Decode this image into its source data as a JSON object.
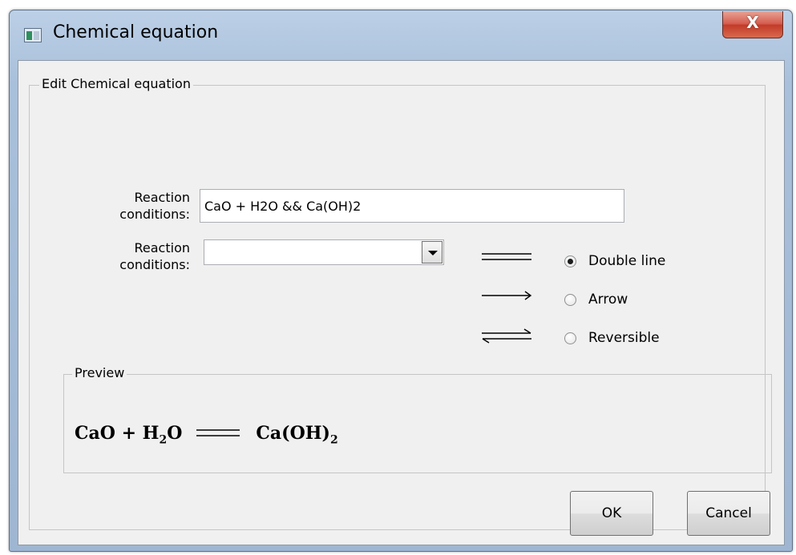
{
  "window": {
    "title": "Chemical equation",
    "close_label": "X"
  },
  "group": {
    "legend": "Edit Chemical equation"
  },
  "equation_field": {
    "label_line1": "Reaction",
    "label_line2": "conditions:",
    "value": "CaO + H2O && Ca(OH)2"
  },
  "conditions_field": {
    "label_line1": "Reaction",
    "label_line2": "conditions:",
    "selected": ""
  },
  "arrow_types": [
    {
      "label": "Double line",
      "symbol_icon": "double-line-icon",
      "selected": true
    },
    {
      "label": "Arrow",
      "symbol_icon": "arrow-icon",
      "selected": false
    },
    {
      "label": "Reversible",
      "symbol_icon": "reversible-arrow-icon",
      "selected": false
    }
  ],
  "preview": {
    "legend": "Preview",
    "left_part1": "CaO + H",
    "left_sub1": "2",
    "left_part2": "O",
    "right_part1": "Ca(OH)",
    "right_sub1": "2"
  },
  "buttons": {
    "ok": "OK",
    "cancel": "Cancel"
  },
  "colors": {
    "window_frame": "#a9c0db",
    "close_button": "#c94a3a",
    "dialog_background": "#f0f0f0"
  }
}
